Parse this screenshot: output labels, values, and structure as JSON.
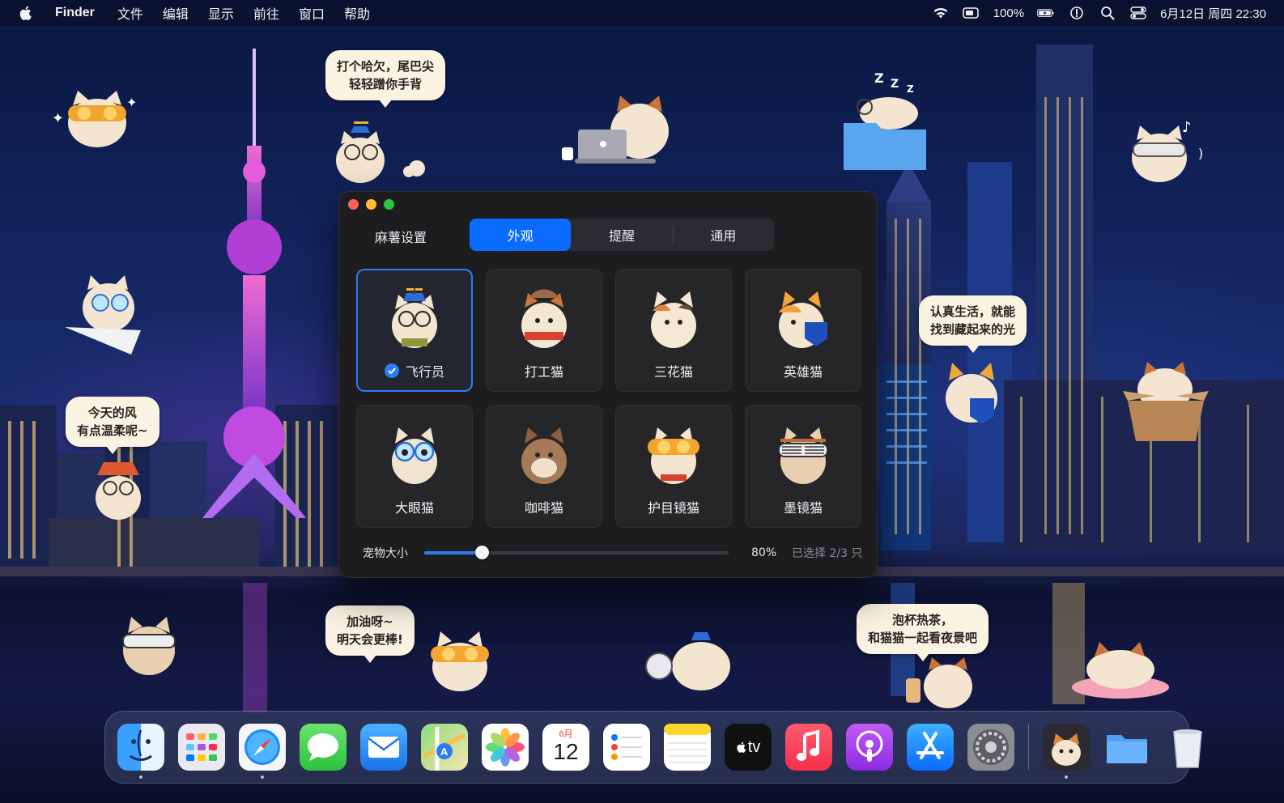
{
  "menubar": {
    "app_name": "Finder",
    "menus": [
      "文件",
      "编辑",
      "显示",
      "前往",
      "窗口",
      "帮助"
    ],
    "status": {
      "battery_percent": "100%",
      "datetime": "6月12日 周四  22:30"
    }
  },
  "bubbles": {
    "yawn": [
      "打个哈欠，尾巴尖",
      "轻轻蹭你手背"
    ],
    "wind": [
      "今天的风",
      "有点温柔呢~"
    ],
    "light": [
      "认真生活，就能",
      "找到藏起来的光"
    ],
    "cheer": [
      "加油呀~",
      "明天会更棒!"
    ],
    "tea": [
      "泡杯热茶，",
      "和猫猫一起看夜景吧"
    ],
    "zzz": "Z Z Z"
  },
  "settings_window": {
    "title": "麻薯设置",
    "tabs": [
      {
        "label": "外观",
        "active": true
      },
      {
        "label": "提醒",
        "active": false
      },
      {
        "label": "通用",
        "active": false
      }
    ],
    "pets": [
      {
        "name": "飞行员",
        "selected": true,
        "accessory": "propeller-cap-glasses",
        "color": "#e7c49a"
      },
      {
        "name": "打工猫",
        "selected": false,
        "accessory": "scarf-cap",
        "color": "#f3e6d3"
      },
      {
        "name": "三花猫",
        "selected": false,
        "accessory": "calico",
        "color": "#f5e9d6"
      },
      {
        "name": "英雄猫",
        "selected": false,
        "accessory": "blue-shield",
        "color": "#f4e5cf"
      },
      {
        "name": "大眼猫",
        "selected": false,
        "accessory": "round-glasses",
        "color": "#f1e4cf"
      },
      {
        "name": "咖啡猫",
        "selected": false,
        "accessory": "brown-coat",
        "color": "#a77a57"
      },
      {
        "name": "护目镜猫",
        "selected": false,
        "accessory": "goggles",
        "color": "#f4e5d0"
      },
      {
        "name": "墨镜猫",
        "selected": false,
        "accessory": "shutter-shades",
        "color": "#e8cfb0"
      }
    ],
    "size_label": "宠物大小",
    "size_value": "80%",
    "size_level": 0.19,
    "selected_count": "已选择 2/3 只"
  },
  "dock": {
    "items": [
      {
        "name": "finder",
        "running": true
      },
      {
        "name": "launchpad",
        "running": false
      },
      {
        "name": "safari",
        "running": true
      },
      {
        "name": "messages",
        "running": false
      },
      {
        "name": "mail",
        "running": false
      },
      {
        "name": "maps",
        "running": false
      },
      {
        "name": "photos",
        "running": false
      },
      {
        "name": "calendar",
        "running": false,
        "month": "6月",
        "day": "12"
      },
      {
        "name": "reminders",
        "running": false
      },
      {
        "name": "notes",
        "running": false
      },
      {
        "name": "apple-tv",
        "running": false,
        "label": "tv"
      },
      {
        "name": "music",
        "running": false
      },
      {
        "name": "podcasts",
        "running": false
      },
      {
        "name": "app-store",
        "running": false
      },
      {
        "name": "system-settings",
        "running": false
      },
      {
        "name": "mochi-pet-app",
        "running": true
      },
      {
        "name": "downloads-folder",
        "running": false
      },
      {
        "name": "trash",
        "running": false
      }
    ]
  },
  "colors": {
    "accent": "#0a6cff",
    "window_bg": "#1d1d20",
    "card_bg": "#262629",
    "bubble_bg": "#fbf3e2"
  }
}
